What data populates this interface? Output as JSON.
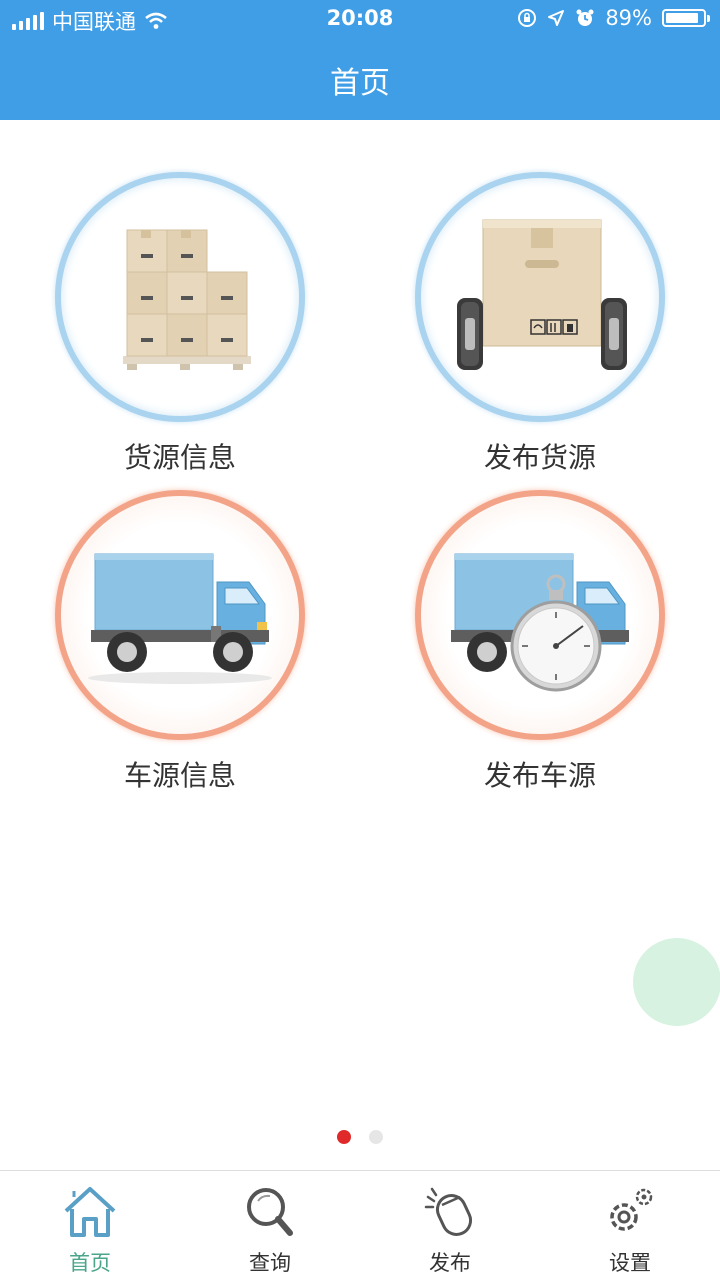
{
  "status_bar": {
    "carrier": "中国联通",
    "time": "20:08",
    "battery": "89%",
    "battery_level": 0.89
  },
  "header": {
    "title": "首页"
  },
  "tiles": [
    {
      "label": "货源信息",
      "icon": "cargo-boxes-icon"
    },
    {
      "label": "发布货源",
      "icon": "box-on-wheels-icon"
    },
    {
      "label": "车源信息",
      "icon": "truck-icon"
    },
    {
      "label": "发布车源",
      "icon": "truck-stopwatch-icon"
    }
  ],
  "pager": {
    "count": 2,
    "active_index": 0
  },
  "tabbar": {
    "items": [
      {
        "label": "首页",
        "icon": "home-icon",
        "active": true
      },
      {
        "label": "查询",
        "icon": "search-icon",
        "active": false
      },
      {
        "label": "发布",
        "icon": "mouse-click-icon",
        "active": false
      },
      {
        "label": "设置",
        "icon": "gear-icon",
        "active": false
      }
    ]
  },
  "colors": {
    "nav_blue": "#3f9ee6",
    "active_tab": "#4aa58a",
    "pager_active": "#e02a2a",
    "float_button": "#d7f2e1"
  }
}
